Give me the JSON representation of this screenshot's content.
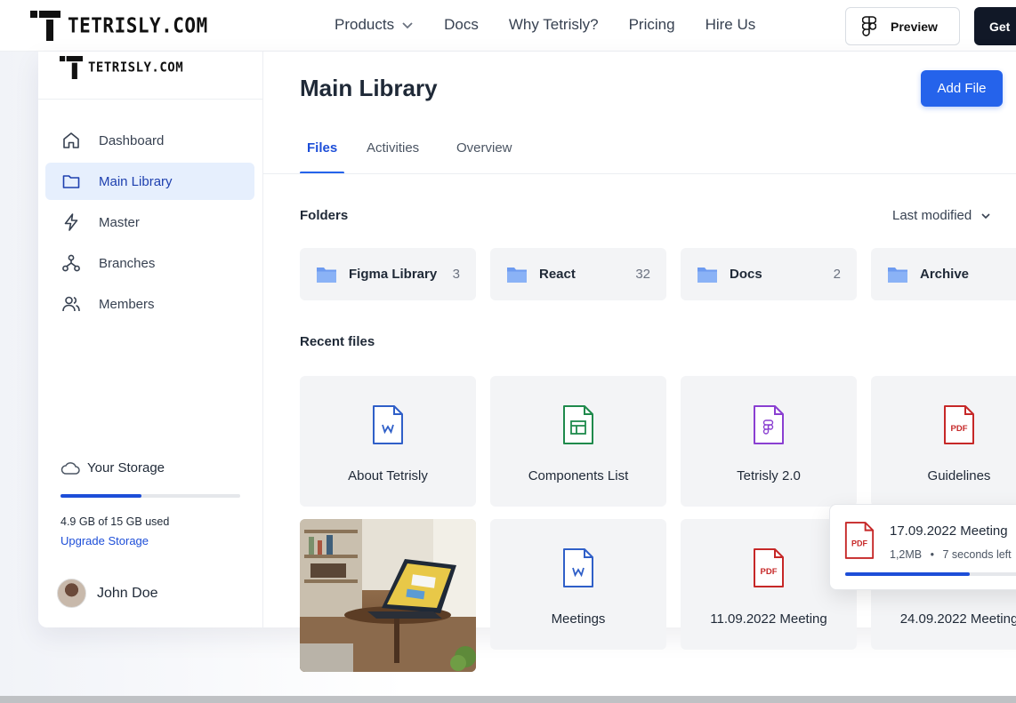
{
  "header": {
    "brand": "TETRISLY.COM",
    "nav": [
      {
        "label": "Products",
        "has_dropdown": true
      },
      {
        "label": "Docs"
      },
      {
        "label": "Why Tetrisly?"
      },
      {
        "label": "Pricing"
      },
      {
        "label": "Hire Us"
      }
    ],
    "preview_label": "Preview",
    "get_label": "Get"
  },
  "sidebar": {
    "brand": "TETRISLY.COM",
    "items": [
      {
        "label": "Dashboard",
        "icon": "home-icon"
      },
      {
        "label": "Main Library",
        "icon": "folder-icon",
        "active": true
      },
      {
        "label": "Master",
        "icon": "lightning-icon"
      },
      {
        "label": "Branches",
        "icon": "branches-icon"
      },
      {
        "label": "Members",
        "icon": "members-icon"
      }
    ],
    "storage": {
      "title": "Your Storage",
      "used_text": "4.9 GB of 15 GB used",
      "fraction": 0.45,
      "upgrade": "Upgrade Storage"
    },
    "user": {
      "name": "John Doe"
    }
  },
  "main": {
    "title": "Main Library",
    "add_button": "Add File",
    "tabs": [
      {
        "label": "Files",
        "active": true
      },
      {
        "label": "Activities"
      },
      {
        "label": "Overview"
      }
    ],
    "folders_label": "Folders",
    "sort_label": "Last modified",
    "folders": [
      {
        "name": "Figma Library",
        "count": "3"
      },
      {
        "name": "React",
        "count": "32"
      },
      {
        "name": "Docs",
        "count": "2"
      },
      {
        "name": "Archive",
        "count": ""
      }
    ],
    "recent_label": "Recent files",
    "files": [
      {
        "name": "About Tetrisly",
        "type": "word"
      },
      {
        "name": "Components List",
        "type": "sheet"
      },
      {
        "name": "Tetrisly 2.0",
        "type": "figma"
      },
      {
        "name": "Guidelines",
        "type": "pdf"
      },
      {
        "name": "Meetings",
        "type": "word"
      },
      {
        "name": "11.09.2022 Meeting",
        "type": "pdf"
      },
      {
        "name": "24.09.2022 Meeting",
        "type": "pdf"
      }
    ],
    "upload": {
      "name": "17.09.2022 Meeting",
      "size": "1,2MB",
      "separator": "•",
      "eta": "7 seconds left",
      "progress": 0.63
    }
  },
  "colors": {
    "accent": "#2563eb",
    "active_bg": "#e6effd",
    "word": "#2f5fc8",
    "sheet": "#1f8a4c",
    "figma": "#8a3fd1",
    "pdf": "#c62828",
    "folder": "#6d9bf0"
  }
}
